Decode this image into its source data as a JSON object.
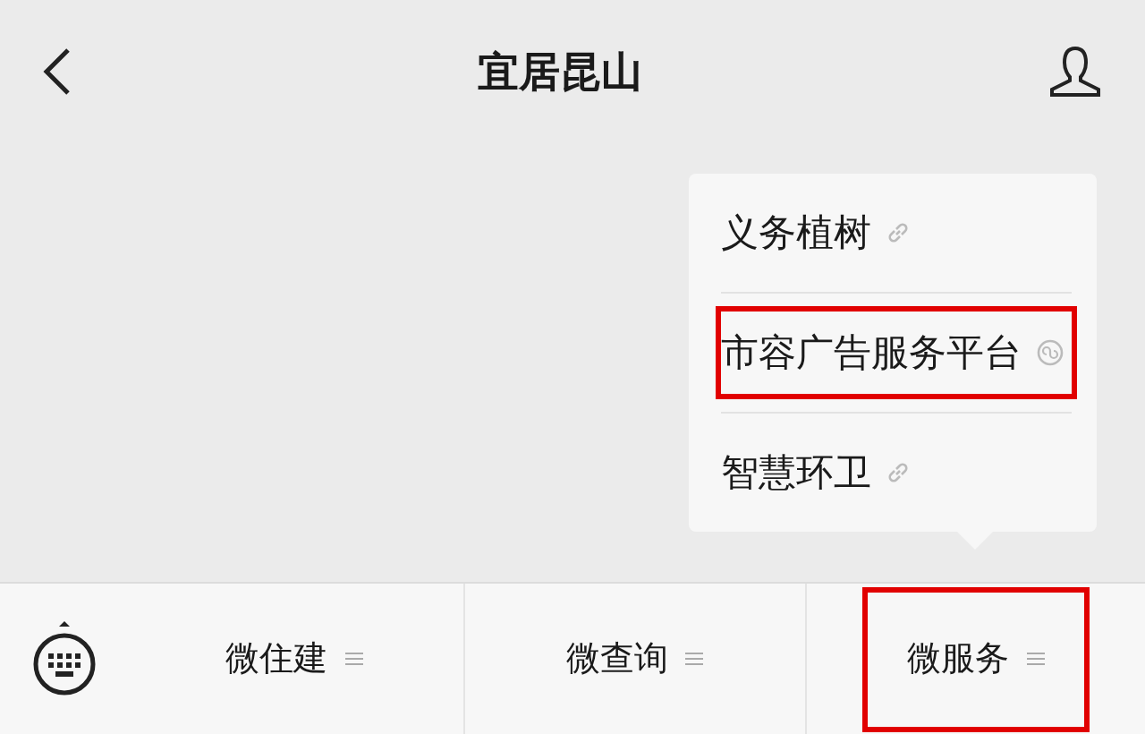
{
  "header": {
    "title": "宜居昆山"
  },
  "popup": {
    "items": [
      {
        "label": "义务植树",
        "kind": "link",
        "highlighted": false
      },
      {
        "label": "市容广告服务平台",
        "kind": "app",
        "highlighted": true
      },
      {
        "label": "智慧环卫",
        "kind": "link",
        "highlighted": false
      }
    ]
  },
  "menu": {
    "items": [
      {
        "label": "微住建",
        "highlighted": false
      },
      {
        "label": "微查询",
        "highlighted": false
      },
      {
        "label": "微服务",
        "highlighted": true
      }
    ]
  }
}
